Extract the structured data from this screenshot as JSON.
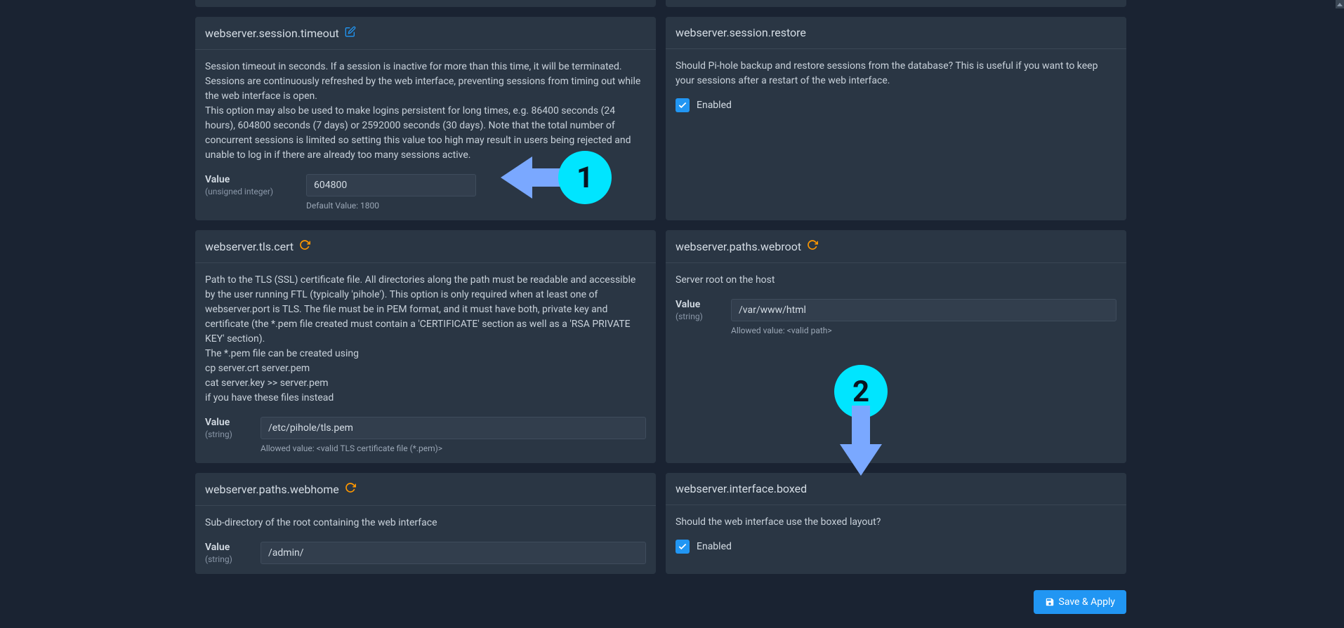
{
  "cards": {
    "timeout": {
      "title": "webserver.session.timeout",
      "description1": "Session timeout in seconds. If a session is inactive for more than this time, it will be terminated. Sessions are continuously refreshed by the web interface, preventing sessions from timing out while the web interface is open.",
      "description2": "This option may also be used to make logins persistent for long times, e.g. 86400 seconds (24 hours), 604800 seconds (7 days) or 2592000 seconds (30 days). Note that the total number of concurrent sessions is limited so setting this value too high may result in users being rejected and unable to log in if there are already too many sessions active.",
      "valueLabel": "Value",
      "valueType": "(unsigned integer)",
      "value": "604800",
      "defaultHint": "Default Value: 1800"
    },
    "restore": {
      "title": "webserver.session.restore",
      "description": "Should Pi-hole backup and restore sessions from the database? This is useful if you want to keep your sessions after a restart of the web interface.",
      "enabledLabel": "Enabled"
    },
    "tlscert": {
      "title": "webserver.tls.cert",
      "description1": "Path to the TLS (SSL) certificate file. All directories along the path must be readable and accessible by the user running FTL (typically 'pihole'). This option is only required when at least one of webserver.port is TLS. The file must be in PEM format, and it must have both, private key and certificate (the *.pem file created must contain a 'CERTIFICATE' section as well as a 'RSA PRIVATE KEY' section).",
      "description2": "The *.pem file can be created using",
      "description3": "cp server.crt server.pem",
      "description4": "cat server.key >> server.pem",
      "description5": "if you have these files instead",
      "valueLabel": "Value",
      "valueType": "(string)",
      "value": "/etc/pihole/tls.pem",
      "allowedHint": "Allowed value: <valid TLS certificate file (*.pem)>"
    },
    "webroot": {
      "title": "webserver.paths.webroot",
      "description": "Server root on the host",
      "valueLabel": "Value",
      "valueType": "(string)",
      "value": "/var/www/html",
      "allowedHint": "Allowed value: <valid path>"
    },
    "webhome": {
      "title": "webserver.paths.webhome",
      "description": "Sub-directory of the root containing the web interface",
      "valueLabel": "Value",
      "valueType": "(string)",
      "value": "/admin/"
    },
    "boxed": {
      "title": "webserver.interface.boxed",
      "description": "Should the web interface use the boxed layout?",
      "enabledLabel": "Enabled"
    }
  },
  "buttons": {
    "save": "Save & Apply"
  },
  "annotations": {
    "one": "1",
    "two": "2"
  }
}
